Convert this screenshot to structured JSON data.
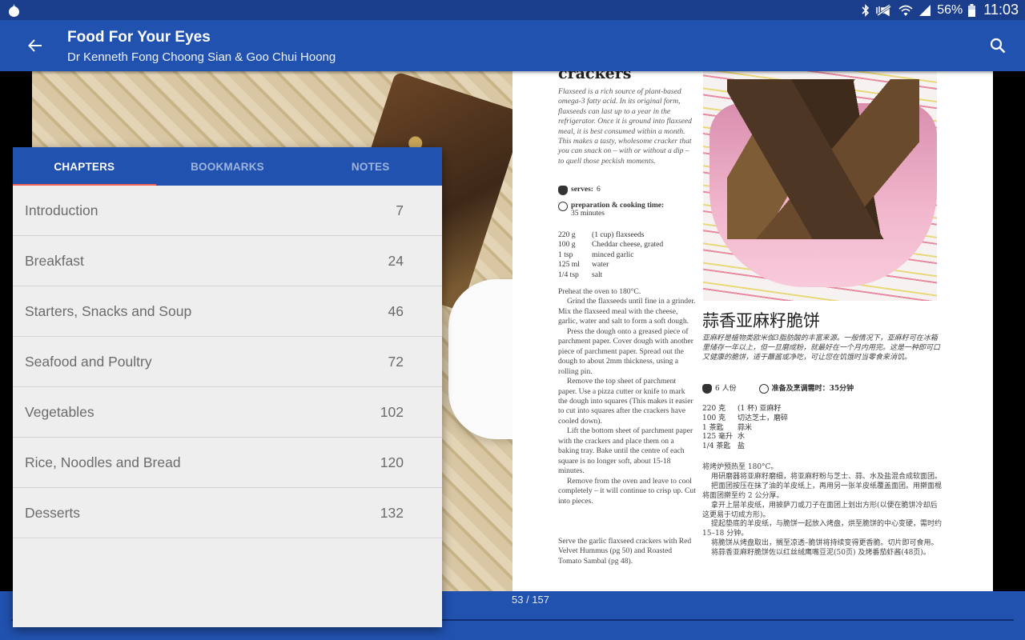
{
  "status_bar": {
    "battery_percent": "56%",
    "time": "11:03",
    "icons": [
      "app-notification-icon",
      "bluetooth-icon",
      "vibrate-icon",
      "wifi-icon",
      "signal-icon",
      "battery-icon"
    ]
  },
  "app_bar": {
    "title": "Food For Your Eyes",
    "subtitle": "Dr Kenneth Fong Choong Sian & Goo Chui Hoong",
    "back_icon": "arrow-back-icon",
    "search_icon": "search-icon"
  },
  "panel": {
    "tabs": [
      {
        "label": "CHAPTERS",
        "active": true
      },
      {
        "label": "BOOKMARKS",
        "active": false
      },
      {
        "label": "NOTES",
        "active": false
      }
    ],
    "chapters": [
      {
        "title": "Introduction",
        "page": "7"
      },
      {
        "title": "Breakfast",
        "page": "24"
      },
      {
        "title": "Starters, Snacks and Soup",
        "page": "46"
      },
      {
        "title": "Seafood and Poultry",
        "page": "72"
      },
      {
        "title": "Vegetables",
        "page": "102"
      },
      {
        "title": "Rice, Noodles and Bread",
        "page": "120"
      },
      {
        "title": "Desserts",
        "page": "132"
      }
    ]
  },
  "reader": {
    "page_indicator": "53 / 157",
    "current_page": 53,
    "total_pages": 157,
    "right_page": {
      "title": "crackers",
      "intro": "Flaxseed is a rich source of plant-based omega-3 fatty acid. In its original form, flaxseeds can last up to a year in the refrigerator. Once it is ground into flaxseed meal, it is best consumed within a month. This makes a tasty, wholesome cracker that you can snack on – with or without a dip – to quell those peckish moments.",
      "serves_label": "serves:",
      "serves_value": "6",
      "time_label": "preparation & cooking time:",
      "time_value": "35 minutes",
      "ingredients": [
        {
          "qty": "220 g",
          "item": "(1 cup) flaxseeds"
        },
        {
          "qty": "100 g",
          "item": "Cheddar cheese, grated"
        },
        {
          "qty": "1 tsp",
          "item": "minced garlic"
        },
        {
          "qty": "125 ml",
          "item": "water"
        },
        {
          "qty": "1/4 tsp",
          "item": "salt"
        }
      ],
      "method": [
        "Preheat the oven to 180°C.",
        "Grind the flaxseeds until fine in a grinder. Mix the flaxseed meal with the cheese, garlic, water and salt to form a soft dough.",
        "Press the dough onto a greased piece of parchment paper. Cover dough with another piece of parchment paper. Spread out the dough to about 2mm thickness, using a rolling pin.",
        "Remove the top sheet of parchment paper. Use a pizza cutter or knife to mark the dough into squares (This makes it easier to cut into squares after the crackers have cooled down).",
        "Lift the bottom sheet of parchment paper with the crackers and place them on a baking tray. Bake until the centre of each square is no longer soft, about 15-18 minutes.",
        "Remove from the oven and leave to cool completely – it will continue to crisp up. Cut into pieces."
      ],
      "serve_note": "Serve the garlic flaxseed crackers with Red Velvet Hummus (pg 50) and Roasted Tomato Sambal (pg 48).",
      "zh_title": "蒜香亚麻籽脆饼",
      "zh_intro": "亚麻籽是植物类欧米伽3脂肪酸的丰富来源。一般情况下，亚麻籽可在冰箱里储存一年以上，但一旦磨成粉，就最好在一个月内用完。这是一种即可口又健康的脆饼，适于蘸酱或净吃，可让您在饥饿时当零食来消饥。",
      "zh_serves": "6 人份",
      "zh_time": "准备及烹调需时：35分钟",
      "zh_ingredients": [
        {
          "qty": "220 克",
          "item": "(1 杯) 亚麻籽"
        },
        {
          "qty": "100 克",
          "item": "切达芝士，磨碎"
        },
        {
          "qty": "1 茶匙",
          "item": "蒜米"
        },
        {
          "qty": "125 毫升",
          "item": "水"
        },
        {
          "qty": "1/4 茶匙",
          "item": "盐"
        }
      ],
      "zh_method": [
        "将烤炉预热至 180°C。",
        "用研磨器将亚麻籽磨细，将亚麻籽粉与芝士、蒜、水及盐混合成软面团。",
        "把面团按压在抹了油的羊皮纸上，再用另一张羊皮纸覆盖面团。用擀面棍将面团擀至约 2 公分厚。",
        "拿开上层羊皮纸，用披萨刀或刀子在面团上划出方形(以便在脆饼冷却后这更易于切成方形)。",
        "提起垫底的羊皮纸，与脆饼一起放入烤盘，烘至脆饼的中心变硬，需时约 15–18 分钟。",
        "将脆饼从烤盘取出，搁至凉透–脆饼将持续变得更香脆。切片即可食用。",
        "将蒜香亚麻籽脆饼佐以红丝绒鹰嘴豆泥(50页) 及烤番茄虾酱(48页)。"
      ]
    }
  }
}
